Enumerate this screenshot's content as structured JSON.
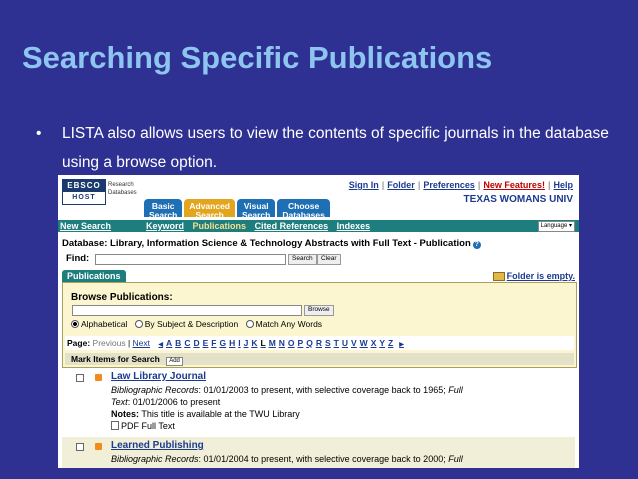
{
  "slide": {
    "title": "Searching Specific Publications",
    "bullet": "LISTA also allows users to view the contents of specific journals in the database using a browse option."
  },
  "ebsco": {
    "logo_line1": "EBSCO",
    "logo_line2": "HOST",
    "logo_sub1": "Research",
    "logo_sub2": "Databases",
    "top_links": [
      "Sign In",
      "Folder",
      "Preferences",
      "New Features!",
      "Help"
    ],
    "institution": "TEXAS WOMANS UNIV",
    "tabs": [
      {
        "line1": "Basic",
        "line2": "Search"
      },
      {
        "line1": "Advanced",
        "line2": "Search"
      },
      {
        "line1": "Visual",
        "line2": "Search"
      },
      {
        "line1": "Choose",
        "line2": "Databases"
      }
    ],
    "new_search": "New Search",
    "nav_links": [
      "Keyword",
      "Publications",
      "Cited References",
      "Indexes"
    ],
    "language": "Language",
    "database_line": "Database: Library, Information Science & Technology Abstracts with Full Text - Publication",
    "find_label": "Find:",
    "search_btn": "Search",
    "clear_btn": "Clear",
    "pub_tab": "Publications",
    "folder_status": "Folder is empty.",
    "browse_title": "Browse Publications:",
    "browse_btn": "Browse",
    "radio_options": [
      "Alphabetical",
      "By Subject & Description",
      "Match Any Words"
    ],
    "page_label": "Page:",
    "prev": "Previous",
    "next": "Next",
    "letters": [
      "A",
      "B",
      "C",
      "D",
      "E",
      "F",
      "G",
      "H",
      "I",
      "J",
      "K",
      "L",
      "M",
      "N",
      "O",
      "P",
      "Q",
      "R",
      "S",
      "T",
      "U",
      "V",
      "W",
      "X",
      "Y",
      "Z"
    ],
    "current_letter": "L",
    "mark_items": "Mark Items for Search",
    "add_btn": "Add",
    "results": [
      {
        "title": "Law Library Journal",
        "line1_label": "Bibliographic Records",
        "line1_text": ": 01/01/2003 to present, with selective coverage back to 1965; ",
        "line1_label2": "Full",
        "line2_label": "Text",
        "line2_text": ": 01/01/2006 to present",
        "notes_label": "Notes:",
        "notes_text": " This title is available at the TWU Library",
        "pdf": "PDF Full Text"
      },
      {
        "title": "Learned Publishing",
        "line1_label": "Bibliographic Records",
        "line1_text": ": 01/01/2004 to present, with selective coverage back to 2000; ",
        "line1_label2": "Full"
      }
    ]
  }
}
